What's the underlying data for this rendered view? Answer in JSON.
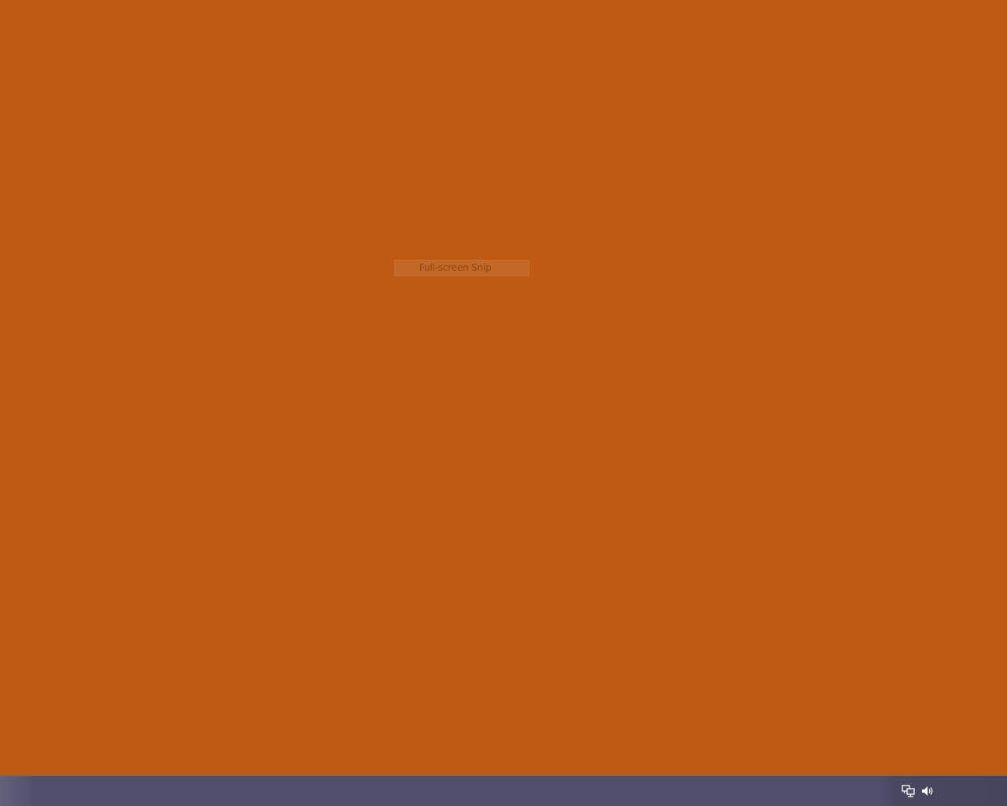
{
  "desktop": {
    "background_color": "#bf5a13"
  },
  "snip_menu": {
    "item_label": "Full-screen Snip"
  },
  "taskbar": {
    "background_color": "#50506c",
    "tray_icons": [
      "network-icon",
      "volume-icon"
    ]
  }
}
